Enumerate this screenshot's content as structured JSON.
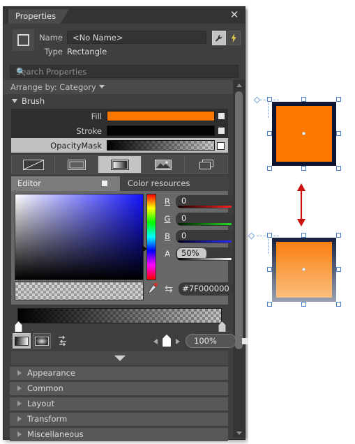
{
  "window": {
    "tab_label": "Properties",
    "close_icon": "close-icon"
  },
  "header": {
    "shape_icon": "rectangle-icon",
    "name_label": "Name",
    "name_value": "<No Name>",
    "type_label": "Type",
    "type_value": "Rectangle",
    "wrench_icon": "wrench-icon",
    "lightning_icon": "lightning-icon"
  },
  "search": {
    "placeholder": "Search Properties",
    "icon": "search-icon"
  },
  "arrange": {
    "label": "Arrange by: Category",
    "caret_icon": "chevron-down-icon"
  },
  "brush_group": {
    "title": "Brush",
    "rows": [
      {
        "label": "Fill",
        "type": "solid",
        "color": "#FA7800",
        "checked": true,
        "selected": false
      },
      {
        "label": "Stroke",
        "type": "solid",
        "color": "#050505",
        "checked": true,
        "selected": false
      },
      {
        "label": "OpacityMask",
        "type": "gradient",
        "color": "#000000",
        "checked": false,
        "selected": true
      }
    ]
  },
  "brush_types": [
    {
      "name": "no-brush",
      "icon": "diagonal-slash-icon",
      "active": false
    },
    {
      "name": "solid-color-brush",
      "icon": "solid-square-icon",
      "active": false
    },
    {
      "name": "gradient-brush",
      "icon": "gradient-square-icon",
      "active": true
    },
    {
      "name": "image-brush",
      "icon": "picture-icon",
      "active": false
    },
    {
      "name": "visual-brush",
      "icon": "layers-icon",
      "active": false
    }
  ],
  "editor_tabs": [
    {
      "label": "Editor",
      "active": true
    },
    {
      "label": "Color resources",
      "active": false
    }
  ],
  "color_editor": {
    "channels": [
      {
        "key": "R",
        "value": "0",
        "bar": "#ff2020"
      },
      {
        "key": "G",
        "value": "0",
        "bar": "#22dd22"
      },
      {
        "key": "B",
        "value": "0",
        "bar": "#2a2aff"
      },
      {
        "key": "A",
        "value": "50%",
        "bar": "checker"
      }
    ],
    "hex_value": "#7F000000",
    "eyedropper_icon": "eyedropper-icon",
    "swap_icon": "swap-arrows-icon"
  },
  "gradient_bar": {
    "stops": [
      {
        "position": "0%",
        "color": "#000000",
        "alpha": 1
      },
      {
        "position": "100%",
        "color": "#000000",
        "alpha": 0
      }
    ]
  },
  "bottom_toolbar": {
    "linear_gradient": {
      "icon": "linear-gradient-icon",
      "active": true
    },
    "radial_gradient": {
      "icon": "radial-gradient-icon",
      "active": false
    },
    "reverse_icon": "reverse-stops-icon",
    "left_arrow_icon": "triangle-left-icon",
    "right_arrow_icon": "triangle-right-icon",
    "stop_marker_icon": "gradient-stop-icon",
    "zoom_value": "100%",
    "zoom_checkbox_checked": true
  },
  "collapse_icon": "chevron-down-icon",
  "categories": [
    {
      "label": "Appearance"
    },
    {
      "label": "Common"
    },
    {
      "label": "Layout"
    },
    {
      "label": "Transform"
    },
    {
      "label": "Miscellaneous"
    }
  ],
  "canvas": {
    "top_shape": {
      "name": "rectangle-solid-fill",
      "fill": "#FA7800",
      "stroke": "#0d1530",
      "selected": true
    },
    "bottom_shape": {
      "name": "rectangle-gradient-fill",
      "fill_top": "#F97A08",
      "fill_bottom": "#FBC486",
      "stroke_top": "#14203f",
      "stroke_bottom": "#9aa3b5",
      "selected": true
    },
    "arrow": {
      "name": "vertical-double-arrow",
      "color": "#CC1111"
    }
  }
}
